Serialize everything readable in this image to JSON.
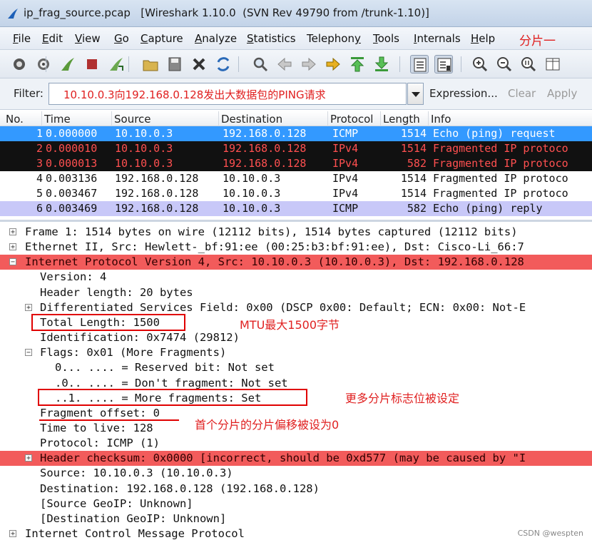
{
  "window": {
    "title": "ip_frag_source.pcap   [Wireshark 1.10.0  (SVN Rev 49790 from /trunk-1.10)]"
  },
  "menu": {
    "items": [
      {
        "ul": "F",
        "rest": "ile"
      },
      {
        "ul": "E",
        "rest": "dit"
      },
      {
        "ul": "V",
        "rest": "iew"
      },
      {
        "ul": "G",
        "rest": "o"
      },
      {
        "ul": "C",
        "rest": "apture"
      },
      {
        "ul": "A",
        "rest": "nalyze"
      },
      {
        "ul": "S",
        "rest": "tatistics"
      },
      {
        "ul": "",
        "rest": "Telephon",
        "ul2": "y"
      },
      {
        "ul": "T",
        "rest": "ools"
      },
      {
        "ul": "I",
        "rest": "nternals"
      },
      {
        "ul": "H",
        "rest": "elp"
      }
    ],
    "annotation": "分片一"
  },
  "toolbar": {
    "icons": [
      "interface-list-icon",
      "capture-options-icon",
      "start-capture-icon",
      "stop-capture-icon",
      "restart-capture-icon",
      "open-file-icon",
      "save-file-icon",
      "close-file-icon",
      "reload-icon",
      "find-packet-icon",
      "go-back-icon",
      "go-forward-icon",
      "go-to-packet-icon",
      "go-first-icon",
      "go-last-icon",
      "colorize-icon",
      "auto-scroll-icon",
      "zoom-in-icon",
      "zoom-out-icon",
      "normal-size-icon",
      "resize-columns-icon"
    ]
  },
  "filter": {
    "label": "Filter:",
    "value": "10.10.0.3向192.168.0.128发出大数据包的PING请求",
    "expression_label": "Expression...",
    "clear_label": "Clear",
    "apply_label": "Apply"
  },
  "packet_list": {
    "columns": [
      "No.",
      "Time",
      "Source",
      "Destination",
      "Protocol",
      "Length",
      "Info"
    ],
    "rows": [
      {
        "no": "1",
        "time": "0.000000",
        "source": "10.10.0.3",
        "destination": "192.168.0.128",
        "protocol": "ICMP",
        "length": "1514",
        "info": "Echo (ping) request",
        "style": "selected"
      },
      {
        "no": "2",
        "time": "0.000010",
        "source": "10.10.0.3",
        "destination": "192.168.0.128",
        "protocol": "IPv4",
        "length": "1514",
        "info": "Fragmented IP protoco",
        "style": "black"
      },
      {
        "no": "3",
        "time": "0.000013",
        "source": "10.10.0.3",
        "destination": "192.168.0.128",
        "protocol": "IPv4",
        "length": "582",
        "info": "Fragmented IP protoco",
        "style": "black"
      },
      {
        "no": "4",
        "time": "0.003136",
        "source": "192.168.0.128",
        "destination": "10.10.0.3",
        "protocol": "IPv4",
        "length": "1514",
        "info": "Fragmented IP protoco",
        "style": "white"
      },
      {
        "no": "5",
        "time": "0.003467",
        "source": "192.168.0.128",
        "destination": "10.10.0.3",
        "protocol": "IPv4",
        "length": "1514",
        "info": "Fragmented IP protoco",
        "style": "white"
      },
      {
        "no": "6",
        "time": "0.003469",
        "source": "192.168.0.128",
        "destination": "10.10.0.3",
        "protocol": "ICMP",
        "length": "582",
        "info": "Echo (ping) reply",
        "style": "lavender"
      }
    ],
    "row_colors": {
      "selected": {
        "bg": "#3399ff",
        "fg": "#ffffff"
      },
      "black": {
        "bg": "#111111",
        "fg": "#ff5050"
      },
      "white": {
        "bg": "#ffffff",
        "fg": "#111111"
      },
      "lavender": {
        "bg": "#c8c8f8",
        "fg": "#111111"
      }
    }
  },
  "detail": {
    "lines": [
      {
        "text": "Frame 1: 1514 bytes on wire (12112 bits), 1514 bytes captured (12112 bits)",
        "level": 0,
        "expander": "+"
      },
      {
        "text": "Ethernet II, Src: Hewlett-_bf:91:ee (00:25:b3:bf:91:ee), Dst: Cisco-Li_66:7",
        "level": 0,
        "expander": "+"
      },
      {
        "text": "Internet Protocol Version 4, Src: 10.10.0.3 (10.10.0.3), Dst: 192.168.0.128",
        "level": 0,
        "expander": "-",
        "highlight": "red"
      },
      {
        "text": "Version: 4",
        "level": 1,
        "expander": ""
      },
      {
        "text": "Header length: 20 bytes",
        "level": 1,
        "expander": ""
      },
      {
        "text": "Differentiated Services Field: 0x00 (DSCP 0x00: Default; ECN: 0x00: Not-E",
        "level": 1,
        "expander": "+"
      },
      {
        "text": "Total Length: 1500",
        "level": 1,
        "expander": ""
      },
      {
        "text": "Identification: 0x7474 (29812)",
        "level": 1,
        "expander": ""
      },
      {
        "text": "Flags: 0x01 (More Fragments)",
        "level": 1,
        "expander": "-"
      },
      {
        "text": "0... .... = Reserved bit: Not set",
        "level": 2,
        "expander": ""
      },
      {
        "text": ".0.. .... = Don't fragment: Not set",
        "level": 2,
        "expander": ""
      },
      {
        "text": "..1. .... = More fragments: Set",
        "level": 2,
        "expander": ""
      },
      {
        "text": "Fragment offset: 0",
        "level": 1,
        "expander": ""
      },
      {
        "text": "Time to live: 128",
        "level": 1,
        "expander": ""
      },
      {
        "text": "Protocol: ICMP (1)",
        "level": 1,
        "expander": ""
      },
      {
        "text": "Header checksum: 0x0000 [incorrect, should be 0xd577 (may be caused by \"I",
        "level": 1,
        "expander": "+",
        "highlight": "red"
      },
      {
        "text": "Source: 10.10.0.3 (10.10.0.3)",
        "level": 1,
        "expander": ""
      },
      {
        "text": "Destination: 192.168.0.128 (192.168.0.128)",
        "level": 1,
        "expander": ""
      },
      {
        "text": "[Source GeoIP: Unknown]",
        "level": 1,
        "expander": ""
      },
      {
        "text": "[Destination GeoIP: Unknown]",
        "level": 1,
        "expander": ""
      },
      {
        "text": "Internet Control Message Protocol",
        "level": 0,
        "expander": "+"
      }
    ],
    "annotations": {
      "mtu": "MTU最大1500字节",
      "more_fragments": "更多分片标志位被设定",
      "offset": "首个分片的分片偏移被设为0"
    }
  },
  "watermark": "CSDN @wespten",
  "colors": {
    "accent": "#e02020",
    "selected": "#3399ff",
    "highlight": "#f25b5b"
  }
}
